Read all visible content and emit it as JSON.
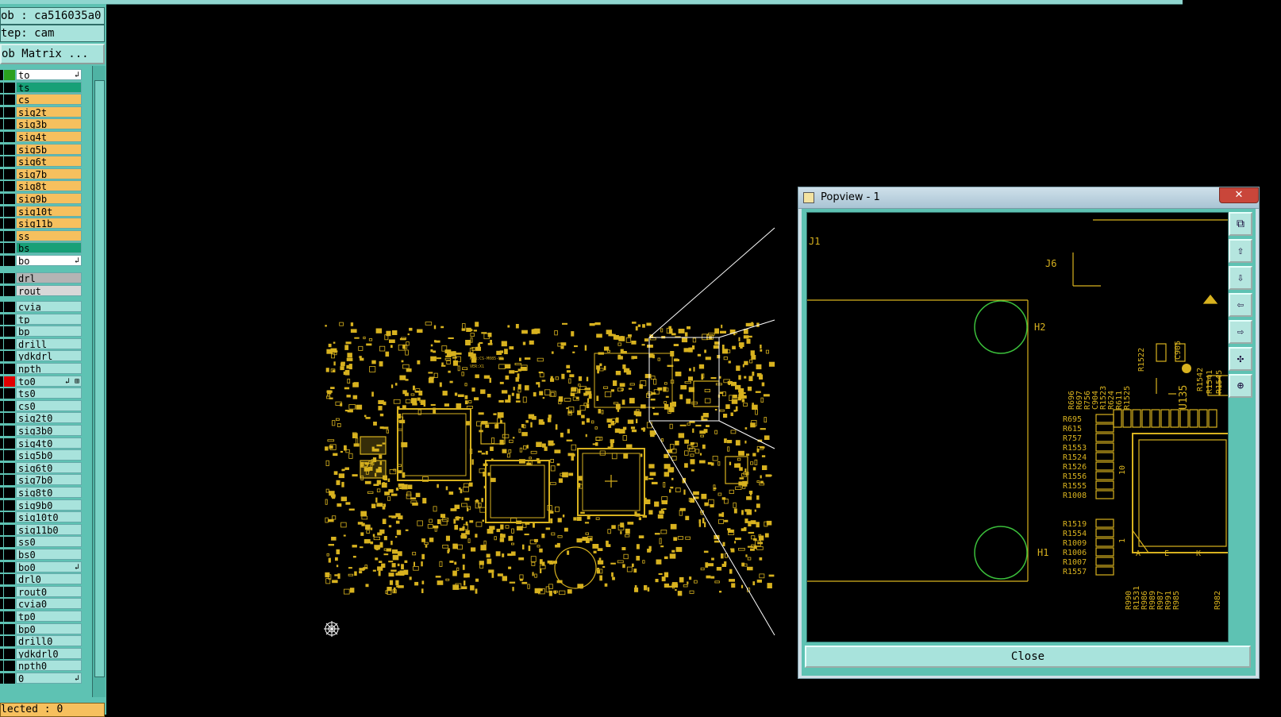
{
  "header": {
    "job": "ob : ca516035a0",
    "step": "tep: cam",
    "matrix_button": "ob Matrix ..."
  },
  "layers_top": [
    {
      "name": "to",
      "color": "#ffffff",
      "swatch": "#2aa01e",
      "arrow": "↲"
    },
    {
      "name": "ts",
      "color": "#17a077",
      "swatch": "#000000"
    },
    {
      "name": "cs",
      "color": "#f6c05e",
      "swatch": "#000000"
    },
    {
      "name": "sig2t",
      "color": "#f6c05e",
      "swatch": "#000000"
    },
    {
      "name": "sig3b",
      "color": "#f6c05e",
      "swatch": "#000000"
    },
    {
      "name": "sig4t",
      "color": "#f6c05e",
      "swatch": "#000000"
    },
    {
      "name": "sig5b",
      "color": "#f6c05e",
      "swatch": "#000000"
    },
    {
      "name": "sig6t",
      "color": "#f6c05e",
      "swatch": "#000000"
    },
    {
      "name": "sig7b",
      "color": "#f6c05e",
      "swatch": "#000000"
    },
    {
      "name": "sig8t",
      "color": "#f6c05e",
      "swatch": "#000000"
    },
    {
      "name": "sig9b",
      "color": "#f6c05e",
      "swatch": "#000000"
    },
    {
      "name": "sig10t",
      "color": "#f6c05e",
      "swatch": "#000000"
    },
    {
      "name": "sig11b",
      "color": "#f6c05e",
      "swatch": "#000000"
    },
    {
      "name": "ss",
      "color": "#f6c05e",
      "swatch": "#000000"
    },
    {
      "name": "bs",
      "color": "#17a077",
      "swatch": "#000000"
    },
    {
      "name": "bo",
      "color": "#ffffff",
      "swatch": "#000000",
      "arrow": "↲"
    }
  ],
  "layers_drill": [
    {
      "name": "drl",
      "color": "#b4b4b4",
      "swatch": "#000000"
    },
    {
      "name": "rout",
      "color": "#d8d8d8",
      "swatch": "#000000"
    }
  ],
  "layers_misc": [
    {
      "name": "cvia",
      "color": "#a8e3dc",
      "swatch": "#000000"
    },
    {
      "name": "tp",
      "color": "#a8e3dc",
      "swatch": "#000000"
    },
    {
      "name": "bp",
      "color": "#a8e3dc",
      "swatch": "#000000"
    },
    {
      "name": "drill",
      "color": "#a8e3dc",
      "swatch": "#000000"
    },
    {
      "name": "ydkdrl",
      "color": "#a8e3dc",
      "swatch": "#000000"
    },
    {
      "name": "npth",
      "color": "#a8e3dc",
      "swatch": "#000000"
    },
    {
      "name": "to0",
      "color": "#a8e3dc",
      "swatch": "#e00000",
      "arrow": "↲ ⊞"
    },
    {
      "name": "ts0",
      "color": "#a8e3dc",
      "swatch": "#000000"
    },
    {
      "name": "cs0",
      "color": "#a8e3dc",
      "swatch": "#000000"
    },
    {
      "name": "sig2t0",
      "color": "#a8e3dc",
      "swatch": "#000000"
    },
    {
      "name": "sig3b0",
      "color": "#a8e3dc",
      "swatch": "#000000"
    },
    {
      "name": "sig4t0",
      "color": "#a8e3dc",
      "swatch": "#000000"
    },
    {
      "name": "sig5b0",
      "color": "#a8e3dc",
      "swatch": "#000000"
    },
    {
      "name": "sig6t0",
      "color": "#a8e3dc",
      "swatch": "#000000"
    },
    {
      "name": "sig7b0",
      "color": "#a8e3dc",
      "swatch": "#000000"
    },
    {
      "name": "sig8t0",
      "color": "#a8e3dc",
      "swatch": "#000000"
    },
    {
      "name": "sig9b0",
      "color": "#a8e3dc",
      "swatch": "#000000"
    },
    {
      "name": "sig10t0",
      "color": "#a8e3dc",
      "swatch": "#000000"
    },
    {
      "name": "sig11b0",
      "color": "#a8e3dc",
      "swatch": "#000000"
    },
    {
      "name": "ss0",
      "color": "#a8e3dc",
      "swatch": "#000000"
    },
    {
      "name": "bs0",
      "color": "#a8e3dc",
      "swatch": "#000000"
    },
    {
      "name": "bo0",
      "color": "#a8e3dc",
      "swatch": "#000000",
      "arrow": "↲"
    },
    {
      "name": "drl0",
      "color": "#a8e3dc",
      "swatch": "#000000"
    },
    {
      "name": "rout0",
      "color": "#a8e3dc",
      "swatch": "#000000"
    },
    {
      "name": "cvia0",
      "color": "#a8e3dc",
      "swatch": "#000000"
    },
    {
      "name": "tp0",
      "color": "#a8e3dc",
      "swatch": "#000000"
    },
    {
      "name": "bp0",
      "color": "#a8e3dc",
      "swatch": "#000000"
    },
    {
      "name": "drill0",
      "color": "#a8e3dc",
      "swatch": "#000000"
    },
    {
      "name": "ydkdrl0",
      "color": "#a8e3dc",
      "swatch": "#000000"
    },
    {
      "name": "npth0",
      "color": "#a8e3dc",
      "swatch": "#000000"
    },
    {
      "name": "0",
      "color": "#a8e3dc",
      "swatch": "#000000",
      "arrow": "↲"
    }
  ],
  "status": "lected : 0",
  "popview": {
    "title": "Popview - 1",
    "close_x": "✕",
    "close_button": "Close",
    "labels": {
      "j1": "J1",
      "j6": "J6",
      "h2": "H2",
      "h1": "H1",
      "r1522": "R1522",
      "c905": "C905",
      "u135": "U135",
      "r1542": "R1542",
      "r1541": "R1541",
      "r1545": "R1545",
      "r696": "R696",
      "r697": "R697",
      "r756": "R756",
      "c904": "C904",
      "r1523": "R1523",
      "r624": "R624",
      "r611": "R611",
      "r1525": "R1525",
      "r695": "R695",
      "r615": "R615",
      "r757": "R757",
      "r1553": "R1553",
      "r1524": "R1524",
      "r1526": "R1526",
      "r1556": "R1556",
      "r1555": "R1555",
      "r1008": "R1008",
      "r1519": "R1519",
      "r1554": "R1554",
      "r1009": "R1009",
      "r1006": "R1006",
      "r1007": "R1007",
      "r1557": "R1557",
      "r990": "R990",
      "r1531": "R1531",
      "r986": "R986",
      "r989": "R989",
      "r987": "R987",
      "r991": "R991",
      "r985": "R985",
      "r982": "R982",
      "n10": "10",
      "n1": "1",
      "pa": "A",
      "pe": "E",
      "pk": "K"
    }
  },
  "pcb_labels": {
    "pn": "P/N:CS-M085-ND",
    "ver": "VER:X1"
  },
  "tool_icons": [
    "zoom-window-icon",
    "pan-up-icon",
    "pan-down-icon",
    "pan-left-icon",
    "pan-right-icon",
    "zoom-fit-icon",
    "zoom-home-icon"
  ],
  "colors": {
    "trace": "#d8b21f",
    "silk": "#d8b21f",
    "hole": "#3bbf3b",
    "bg": "#000000",
    "panel": "#5ec2b3"
  }
}
